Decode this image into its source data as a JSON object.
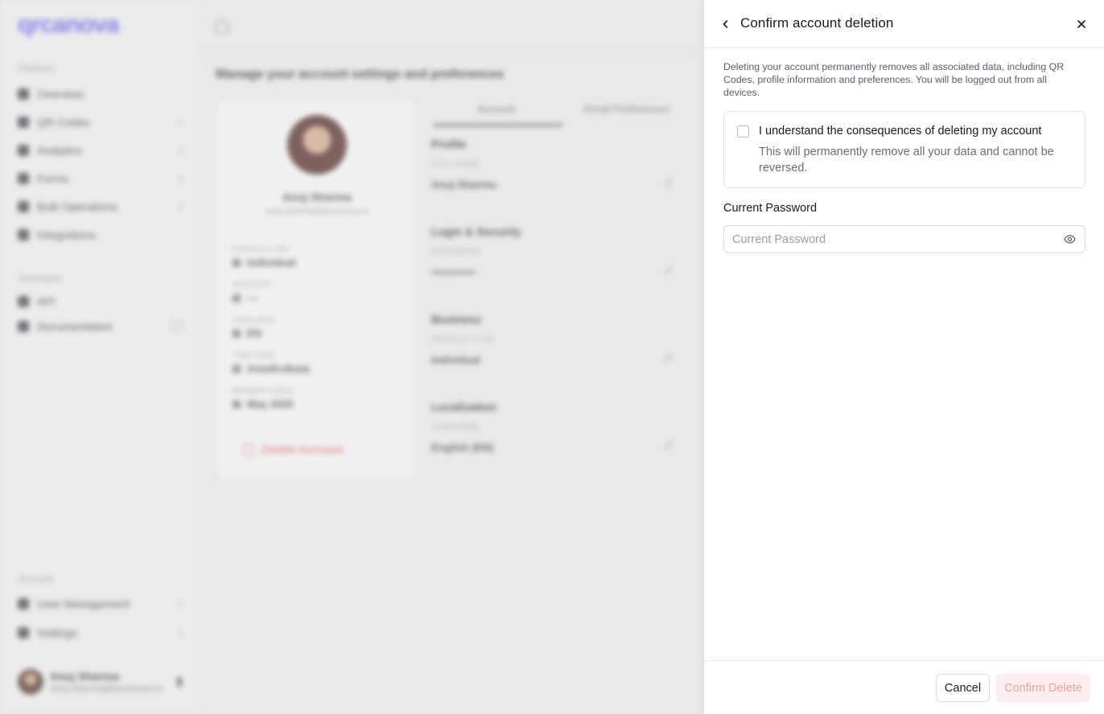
{
  "background": {
    "logo": "qrcanova",
    "sidebar": {
      "sections": [
        {
          "title": "Platform",
          "items": [
            "Overview",
            "QR Codes",
            "Analytics",
            "Forms",
            "Bulk Operations",
            "Integrations"
          ]
        },
        {
          "title": "Developer",
          "items": [
            "API",
            "Documentation"
          ]
        },
        {
          "title": "Account",
          "items": [
            "User Management",
            "Settings"
          ]
        }
      ],
      "user": {
        "name": "Anuj Sharma",
        "email": "anuj.sharma@qrcanova.io"
      }
    },
    "page_title": "Manage your account settings and preferences",
    "profile": {
      "name": "Anuj Sharma",
      "email": "anuj.sharma@qrcanova.io",
      "fields": [
        {
          "label": "PROFILE TYPE",
          "value": "Individual"
        },
        {
          "label": "INDUSTRY",
          "value": "—"
        },
        {
          "label": "LANGUAGE",
          "value": "EN"
        },
        {
          "label": "TIME ZONE",
          "value": "Asia/Kolkata"
        },
        {
          "label": "MEMBER SINCE",
          "value": "May 2025"
        }
      ],
      "delete_label": "Delete Account"
    },
    "tabs": [
      "Account",
      "Email Preferences"
    ],
    "sections": [
      {
        "title": "Profile",
        "label": "FULL NAME",
        "value": "Anuj Sharma"
      },
      {
        "title": "Login & Security",
        "label": "PASSWORD",
        "value": "••••••••••••"
      },
      {
        "title": "Business",
        "label": "PROFILE TYPE",
        "value": "Individual"
      },
      {
        "title": "Localization",
        "label": "LANGUAGE",
        "value": "English (EN)"
      }
    ]
  },
  "drawer": {
    "title": "Confirm account deletion",
    "description": "Deleting your account permanently removes all associated data, including QR Codes, profile information and preferences. You will be logged out from all devices.",
    "acknowledge": {
      "title": "I understand the consequences of deleting my account",
      "subtitle": "This will permanently remove all your data and cannot be reversed.",
      "checked": false
    },
    "password": {
      "label": "Current Password",
      "placeholder": "Current Password",
      "value": ""
    },
    "footer": {
      "cancel_label": "Cancel",
      "confirm_label": "Confirm Delete"
    },
    "colors": {
      "confirm_bg": "#fdeeed",
      "confirm_text": "#f0a39c"
    }
  }
}
